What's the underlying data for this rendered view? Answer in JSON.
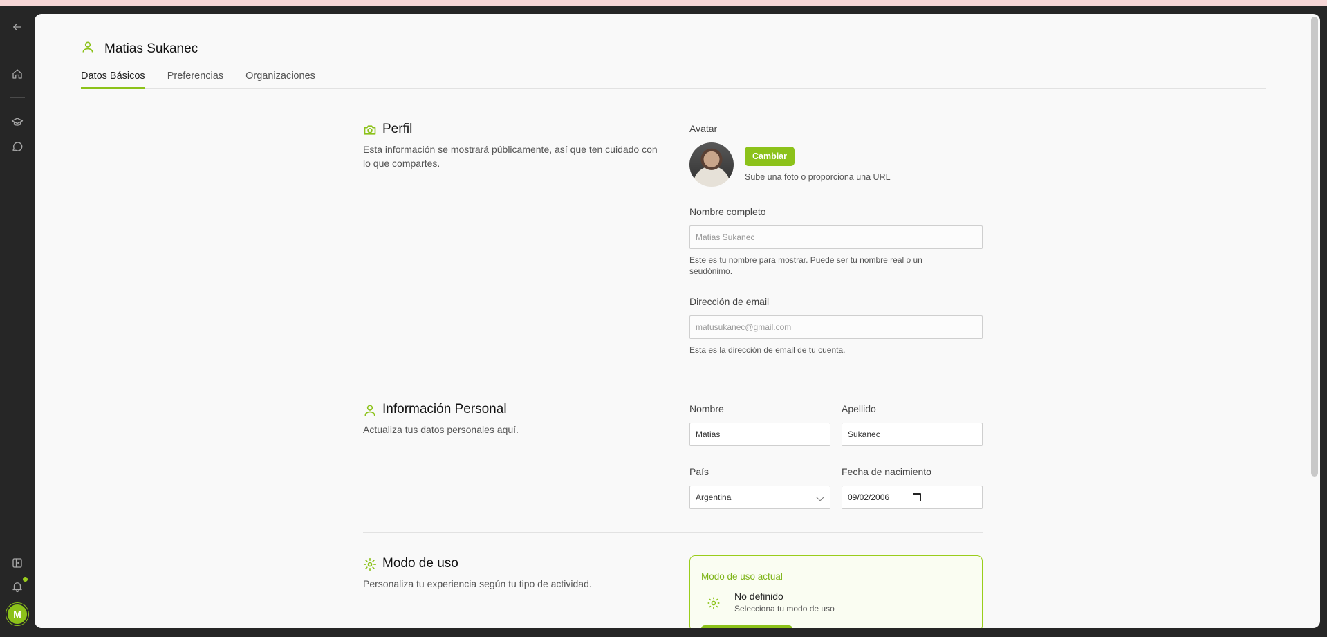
{
  "colors": {
    "accent": "#8cc21a",
    "rail_bg": "#262626",
    "panel_bg": "#f9f9f9"
  },
  "rail": {
    "icons": [
      "back-arrow-icon",
      "home-icon",
      "graduation-cap-icon",
      "chat-bubble-icon",
      "sidebar-toggle-icon",
      "bell-icon"
    ],
    "user_initial": "M"
  },
  "header": {
    "title": "Matias Sukanec",
    "icon": "user-icon"
  },
  "tabs": [
    {
      "label": "Datos Básicos",
      "active": true
    },
    {
      "label": "Preferencias",
      "active": false
    },
    {
      "label": "Organizaciones",
      "active": false
    }
  ],
  "profile": {
    "title": "Perfil",
    "description": "Esta información se mostrará públicamente, así que ten cuidado con lo que compartes.",
    "avatar_label": "Avatar",
    "change_button": "Cambiar",
    "avatar_hint": "Sube una foto o proporciona una URL",
    "fullname_label": "Nombre completo",
    "fullname_placeholder": "Matias Sukanec",
    "fullname_helper": "Este es tu nombre para mostrar. Puede ser tu nombre real o un seudónimo.",
    "email_label": "Dirección de email",
    "email_placeholder": "matusukanec@gmail.com",
    "email_helper": "Esta es la dirección de email de tu cuenta."
  },
  "personal": {
    "title": "Información Personal",
    "description": "Actualiza tus datos personales aquí.",
    "first_name_label": "Nombre",
    "first_name_value": "Matias",
    "last_name_label": "Apellido",
    "last_name_value": "Sukanec",
    "country_label": "País",
    "country_value": "Argentina",
    "birthdate_label": "Fecha de nacimiento",
    "birthdate_value": "09/02/2006"
  },
  "usage": {
    "title": "Modo de uso",
    "description": "Personaliza tu experiencia según tu tipo de actividad.",
    "card_title": "Modo de uso actual",
    "current_value": "No definido",
    "current_hint": "Selecciona tu modo de uso"
  }
}
